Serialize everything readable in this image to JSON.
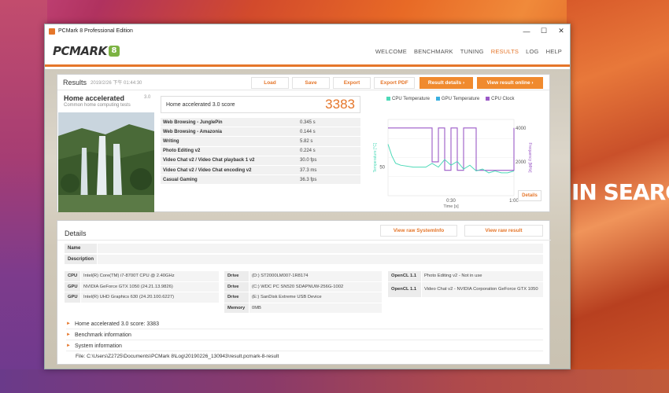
{
  "window": {
    "title": "PCMark 8 Professional Edition",
    "minimize": "—",
    "maximize": "☐",
    "close": "✕"
  },
  "brand": {
    "logo_text": "PCMARK",
    "logo_badge": "8"
  },
  "nav": [
    "WELCOME",
    "BENCHMARK",
    "TUNING",
    "RESULTS",
    "LOG",
    "HELP"
  ],
  "results": {
    "title": "Results",
    "date": "2019/2/26 下午 01:44:30",
    "buttons": {
      "load": "Load",
      "save": "Save",
      "export": "Export",
      "export_pdf": "Export PDF",
      "result_details": "Result details ›",
      "view_online": "View result online ›"
    },
    "test_name": "Home accelerated",
    "test_version": "3.0",
    "test_sub": "Common home computing tests",
    "score_label": "Home accelerated 3.0 score",
    "score_value": "3383",
    "subscores": [
      {
        "k": "Web Browsing - JunglePin",
        "v": "0.345 s"
      },
      {
        "k": "Web Browsing - Amazonia",
        "v": "0.144 s"
      },
      {
        "k": "Writing",
        "v": "5.82 s"
      },
      {
        "k": "Photo Editing v2",
        "v": "0.224 s"
      },
      {
        "k": "Video Chat v2 / Video Chat playback 1 v2",
        "v": "30.0 fps"
      },
      {
        "k": "Video Chat v2 / Video Chat encoding v2",
        "v": "37.3 ms"
      },
      {
        "k": "Casual Gaming",
        "v": "36.3 fps"
      }
    ]
  },
  "chart_data": {
    "type": "line",
    "legend": [
      "CPU Temperature",
      "GPU Temperature",
      "CPU Clock"
    ],
    "colors": {
      "cpu_temp": "#4dd9b8",
      "gpu_temp": "#3ab0e0",
      "cpu_clock": "#9b59c7"
    },
    "x_ticks": [
      "0:30",
      "1:00"
    ],
    "xlabel": "Time [s]",
    "ylabel_left": "Temperature [°C]",
    "ylabel_right": "Frequency [MHz]",
    "y_left_ticks": [
      "50"
    ],
    "y_right_ticks": [
      "4000",
      "2000"
    ],
    "x": [
      0,
      0.03,
      0.06,
      0.1,
      0.2,
      0.3,
      0.35,
      0.4,
      0.45,
      0.5,
      0.55,
      0.6,
      0.65,
      0.7,
      0.75,
      0.8,
      0.85,
      0.9,
      0.95,
      1.0
    ],
    "series": [
      {
        "name": "CPU Temperature",
        "values": [
          62,
          56,
          52,
          51,
          50,
          50,
          52,
          50,
          54,
          51,
          53,
          49,
          51,
          48,
          49,
          47,
          48,
          47,
          47,
          48
        ]
      },
      {
        "name": "CPU Clock",
        "values": [
          4000,
          4000,
          4000,
          4000,
          4000,
          4000,
          2000,
          4000,
          1500,
          4000,
          1500,
          4000,
          4000,
          1500,
          1500,
          1500,
          1500,
          1500,
          1500,
          4000
        ]
      }
    ],
    "details_label": "Details"
  },
  "details": {
    "title": "Details",
    "view_raw_sysinfo": "View raw SystemInfo",
    "view_raw_result": "View raw result",
    "name_label": "Name",
    "description_label": "Description",
    "system_left": [
      {
        "k": "CPU",
        "v": "Intel(R) Core(TM) i7-8700T CPU @ 2.40GHz"
      },
      {
        "k": "GPU",
        "v": "NVIDIA GeForce GTX 1050 (24.21.13.9826)"
      },
      {
        "k": "GPU",
        "v": "Intel(R) UHD Graphics 630 (24.20.100.6227)"
      }
    ],
    "system_mid": [
      {
        "k": "Drive",
        "v": "(D:) ST2000LM007-1R8174"
      },
      {
        "k": "Drive",
        "v": "(C:) WDC PC SN520 SDAPNUW-256G-1002"
      },
      {
        "k": "Drive",
        "v": "(E:) SanDisk Extreme USB Device"
      },
      {
        "k": "Memory",
        "v": "0MB"
      }
    ],
    "system_right": [
      {
        "k": "OpenCL 1.1",
        "v": "Photo Editing v2 - Not in use"
      },
      {
        "k": "OpenCL 1.1",
        "v": "Video Chat v2 - NVIDIA Corporation GeForce GTX 1050"
      }
    ],
    "expanders": [
      "Home accelerated 3.0 score: 3383",
      "Benchmark information",
      "System information"
    ],
    "file_path": "File: C:\\Users\\Z2725\\Documents\\PCMark 8\\Log\\20190226_130943\\result.pcmark-8-result"
  },
  "desktop": {
    "text": "IN SEARCH O"
  }
}
